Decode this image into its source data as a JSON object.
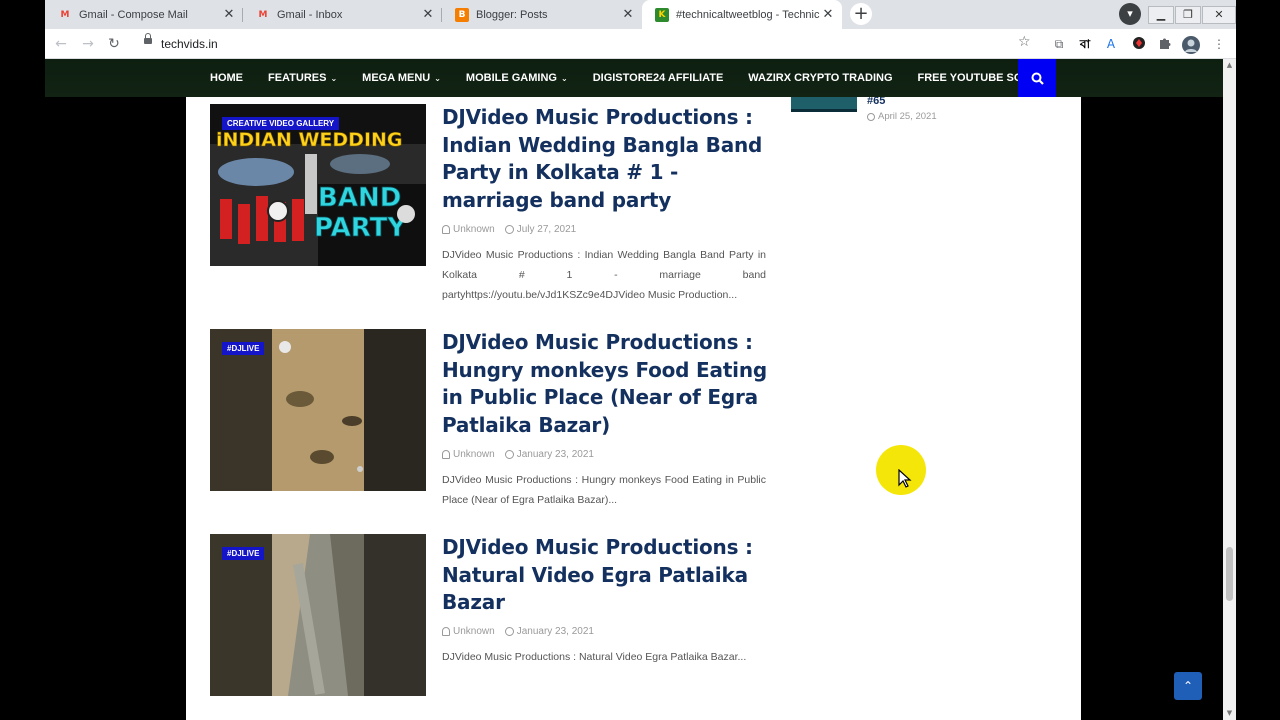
{
  "browser": {
    "tabs": [
      {
        "title": "Gmail - Compose Mail",
        "favicon": "gmail-icon",
        "active": false
      },
      {
        "title": "Gmail - Inbox",
        "favicon": "gmail-icon",
        "active": false
      },
      {
        "title": "Blogger: Posts",
        "favicon": "blogger-icon",
        "active": false
      },
      {
        "title": "#technicaltweetblog - Technical",
        "favicon": "site-icon",
        "active": true
      }
    ],
    "url": "techvids.in",
    "extensions": [
      "বা"
    ]
  },
  "site": {
    "nav": [
      {
        "label": "HOME",
        "dropdown": false
      },
      {
        "label": "FEATURES",
        "dropdown": true
      },
      {
        "label": "MEGA MENU",
        "dropdown": true
      },
      {
        "label": "MOBILE GAMING",
        "dropdown": true
      },
      {
        "label": "DIGISTORE24 AFFILIATE",
        "dropdown": false
      },
      {
        "label": "WAZIRX CRYPTO TRADING",
        "dropdown": false
      },
      {
        "label": "FREE YOUTUBE SONG",
        "dropdown": false
      }
    ],
    "accent": "#0000f5",
    "title_color": "#13305e"
  },
  "posts": [
    {
      "badge": "CREATIVE VIDEO GALLERY",
      "title": "DJVideo Music Productions : Indian Wedding Bangla Band Party in Kolkata # 1 - marriage band party",
      "author": "Unknown",
      "date": "July 27, 2021",
      "snippet": "DJVideo Music Productions : Indian Wedding Bangla Band Party in Kolkata # 1 - marriage band partyhttps://youtu.be/vJd1KSZc9e4DJVideo Music Production...",
      "thumb_text_top": "iNDIAN WEDDING",
      "thumb_text_band": "BAND",
      "thumb_text_party": "PARTY"
    },
    {
      "badge": "#DJLIVE",
      "title": "DJVideo Music Productions : Hungry monkeys Food Eating in Public Place (Near of Egra Patlaika Bazar)",
      "author": "Unknown",
      "date": "January 23, 2021",
      "snippet": "DJVideo Music Productions : Hungry monkeys Food Eating in Public Place (Near of Egra Patlaika Bazar)..."
    },
    {
      "badge": "#DJLIVE",
      "title": "DJVideo Music Productions : Natural Video Egra Patlaika Bazar",
      "author": "Unknown",
      "date": "January 23, 2021",
      "snippet": "DJVideo Music Productions : Natural Video Egra Patlaika Bazar..."
    }
  ],
  "sidebar": {
    "partial_title": "#65",
    "date": "April 25, 2021"
  }
}
